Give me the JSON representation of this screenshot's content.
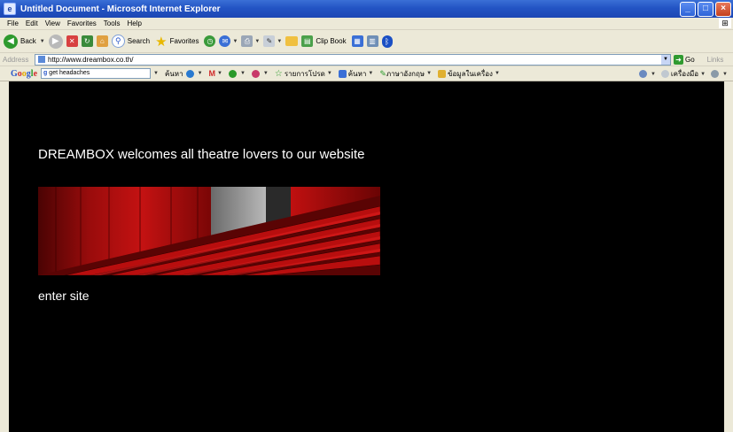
{
  "window": {
    "title": "Untitled Document - Microsoft Internet Explorer"
  },
  "menu": [
    "File",
    "Edit",
    "View",
    "Favorites",
    "Tools",
    "Help"
  ],
  "toolbar": {
    "back": "Back",
    "search": "Search",
    "favorites": "Favorites",
    "clipbook": "Clip Book"
  },
  "address": {
    "label": "Address",
    "url": "http://www.dreambox.co.th/",
    "go": "Go",
    "links": "Links"
  },
  "google": {
    "logo": "Google",
    "search_value": "get headaches",
    "items": [
      "ค้นหา",
      "อีเมล",
      "รายการโปรด",
      "ค้นหา",
      "ภาษาอังกฤษ",
      "ข้อมูลในเครื่อง"
    ],
    "right_label": "เครื่องมือ"
  },
  "page": {
    "welcome": "DREAMBOX welcomes all theatre lovers to our website",
    "enter": "enter site"
  },
  "colors": {
    "titlebar": "#2354c4",
    "content_bg": "#000000",
    "banner_red": "#a80c0c"
  }
}
